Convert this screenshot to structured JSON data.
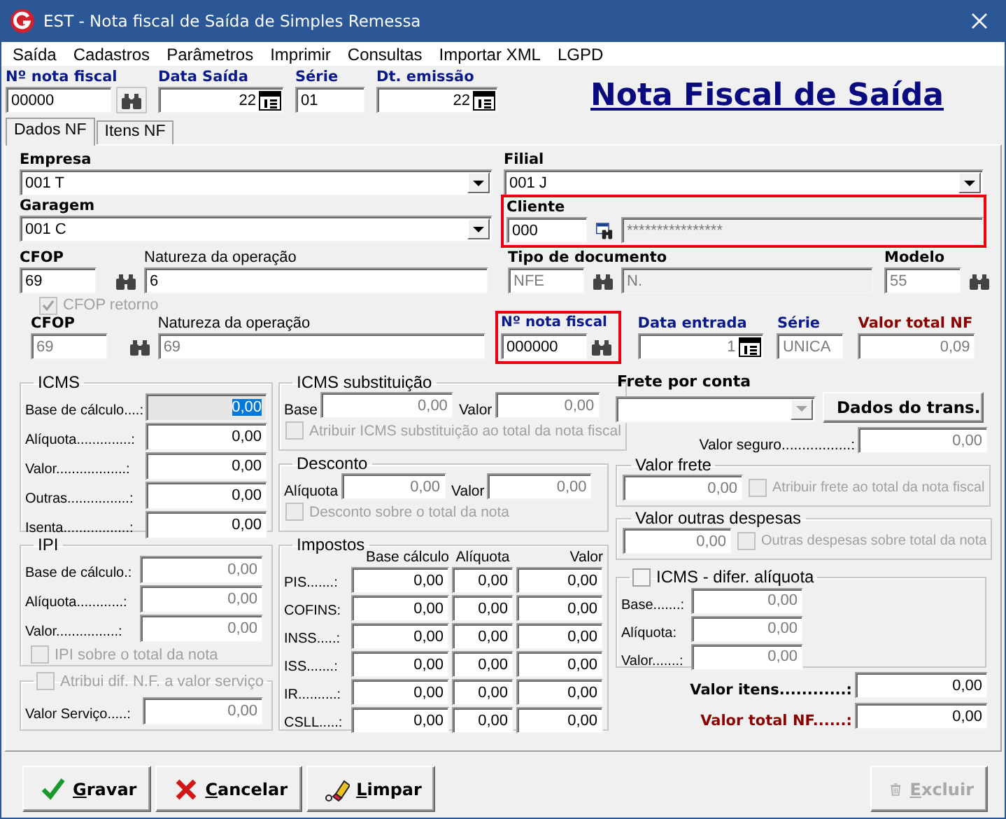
{
  "window": {
    "title": "EST - Nota fiscal de Saída de Simples Remessa"
  },
  "menu": [
    "Saída",
    "Cadastros",
    "Parâmetros",
    "Imprimir",
    "Consultas",
    "Importar XML",
    "LGPD"
  ],
  "header": {
    "heading": "Nota Fiscal de Saída",
    "fields": [
      {
        "label": "Nº nota fiscal",
        "value": "00000",
        "kind": "search"
      },
      {
        "label": "Data Saída",
        "value": "22",
        "kind": "date"
      },
      {
        "label": "Série",
        "value": "01",
        "kind": "text"
      },
      {
        "label": "Dt. emissão",
        "value": "22",
        "kind": "date"
      }
    ]
  },
  "tabs": [
    {
      "label": "Dados NF",
      "selected": true
    },
    {
      "label": "Itens NF",
      "selected": false
    }
  ],
  "empresa": {
    "label": "Empresa",
    "value": "001 T"
  },
  "filial": {
    "label": "Filial",
    "value": "001 J"
  },
  "garagem": {
    "label": "Garagem",
    "value": "001 C"
  },
  "cliente": {
    "label": "Cliente",
    "code": {
      "value": "000"
    },
    "name": {
      "value": "****************",
      "disabled": true
    },
    "highlighted": true
  },
  "cfop": {
    "label": "CFOP",
    "value": "69"
  },
  "natureza": {
    "label": "Natureza da operação",
    "value": "6"
  },
  "tipo_documento": {
    "label": "Tipo de documento",
    "code": {
      "value": "NFE",
      "disabled": true
    },
    "description": {
      "value": "N.",
      "disabled": true
    }
  },
  "modelo": {
    "label": "Modelo",
    "value": "55",
    "disabled": true
  },
  "cfop_retorno": {
    "label": "CFOP retorno",
    "checked": true,
    "disabled": true
  },
  "entrada": {
    "cfop": {
      "label": "CFOP",
      "value": "69",
      "disabled": true
    },
    "natureza": {
      "label": "Natureza da operação",
      "value": "69",
      "disabled": true
    },
    "nota_fiscal": {
      "label": "Nº nota fiscal",
      "value": "000000",
      "highlighted": true
    },
    "data": {
      "label": "Data entrada",
      "value": "1",
      "disabled": true
    },
    "serie": {
      "label": "Série",
      "value": "UNICA",
      "disabled": true
    },
    "valor_total": {
      "label": "Valor total NF",
      "value": "0,09",
      "disabled": true
    }
  },
  "icms": {
    "title": "ICMS",
    "fields": [
      {
        "label": "Base de cálculo....:",
        "value": "0,00",
        "selected": true
      },
      {
        "label": "Alíquota..............:",
        "value": "0,00",
        "selected": false
      },
      {
        "label": "Valor..................:",
        "value": "0,00",
        "selected": false
      },
      {
        "label": "Outras................:",
        "value": "0,00",
        "selected": false
      },
      {
        "label": "Isenta.................:",
        "value": "0,00",
        "selected": false
      }
    ]
  },
  "icms_substituicao": {
    "title": "ICMS substituição",
    "base": {
      "label": "Base",
      "value": "0,00",
      "disabled": true
    },
    "valor": {
      "label": "Valor",
      "value": "0,00",
      "disabled": true
    },
    "option": {
      "label": "Atribuir ICMS substituição ao total da nota fiscal",
      "checked": false,
      "disabled": true
    }
  },
  "desconto": {
    "title": "Desconto",
    "aliquota": {
      "label": "Alíquota",
      "value": "0,00",
      "disabled": true
    },
    "valor": {
      "label": "Valor",
      "value": "0,00",
      "disabled": true
    },
    "option": {
      "label": "Desconto sobre o total da nota",
      "checked": false,
      "disabled": true
    }
  },
  "ipi": {
    "title": "IPI",
    "fields": [
      {
        "label": "Base de cálculo.:",
        "value": "0,00",
        "disabled": true
      },
      {
        "label": "Alíquota............:",
        "value": "0,00",
        "disabled": true
      },
      {
        "label": "Valor................:",
        "value": "0,00",
        "disabled": true
      }
    ],
    "option": {
      "label": "IPI sobre o total da nota",
      "checked": false,
      "disabled": true
    }
  },
  "servico": {
    "option": {
      "label": "Atribui dif. N.F. a valor serviço",
      "checked": false,
      "disabled": true
    },
    "field": {
      "label": "Valor Serviço.....:",
      "value": "0,00",
      "disabled": true
    }
  },
  "impostos": {
    "title": "Impostos",
    "columns": [
      "Base cálculo",
      "Alíquota",
      "Valor"
    ],
    "rows": [
      {
        "label": "PIS.......:",
        "values": [
          "0,00",
          "0,00",
          "0,00"
        ]
      },
      {
        "label": "COFINS:",
        "values": [
          "0,00",
          "0,00",
          "0,00"
        ]
      },
      {
        "label": "INSS.....:",
        "values": [
          "0,00",
          "0,00",
          "0,00"
        ]
      },
      {
        "label": "ISS.......:",
        "values": [
          "0,00",
          "0,00",
          "0,00"
        ]
      },
      {
        "label": "IR..........:",
        "values": [
          "0,00",
          "0,00",
          "0,00"
        ]
      },
      {
        "label": "CSLL.....:",
        "values": [
          "0,00",
          "0,00",
          "0,00"
        ]
      }
    ]
  },
  "frete": {
    "label": "Frete por conta",
    "dropdown": {
      "disabled": true
    },
    "button": "Dados do trans.",
    "seguro": {
      "label": "Valor seguro.................:",
      "value": "0,00",
      "disabled": true
    },
    "valor_frete": {
      "title": "Valor frete",
      "field": {
        "value": "0,00",
        "disabled": true
      },
      "option": {
        "label": "Atribuir frete ao total da nota fiscal",
        "checked": false,
        "disabled": true
      }
    },
    "outras_despesas": {
      "title": "Valor outras despesas",
      "field": {
        "value": "0,00",
        "disabled": true
      },
      "option": {
        "label": "Outras despesas sobre total da nota",
        "checked": false,
        "disabled": true
      }
    },
    "icms_difer": {
      "title": "ICMS - difer. alíquota",
      "checked": false,
      "fields": [
        {
          "label": "Base.......:",
          "value": "0,00",
          "disabled": true
        },
        {
          "label": "Alíquota:",
          "value": "0,00",
          "disabled": true
        },
        {
          "label": "Valor.......:",
          "value": "0,00",
          "disabled": true
        }
      ]
    }
  },
  "totais": [
    {
      "label": "Valor itens............:",
      "value": "0,00",
      "kind": "items"
    },
    {
      "label": "Valor total NF......:",
      "value": "0,00",
      "kind": "total"
    }
  ],
  "buttons": [
    {
      "label": "Gravar",
      "disabled": false
    },
    {
      "label": "Cancelar",
      "disabled": false
    },
    {
      "label": "Limpar",
      "disabled": false
    },
    {
      "label": "Excluir",
      "disabled": true
    }
  ]
}
